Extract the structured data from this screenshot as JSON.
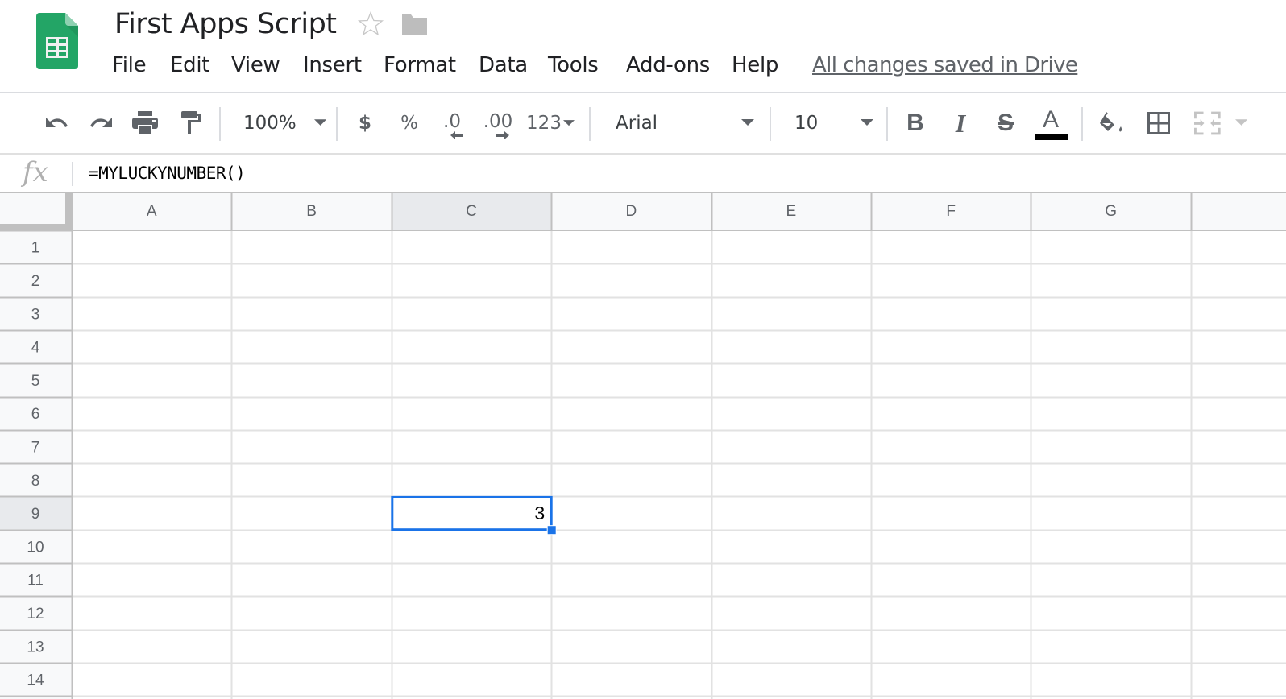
{
  "app": {
    "name": "Google Sheets",
    "title": "First Apps Script",
    "icons": {
      "logo": "sheets-logo-icon",
      "star": "star-icon",
      "folder": "folder-icon"
    },
    "brand_color": "#23a566"
  },
  "menu": {
    "items": [
      {
        "label": "File"
      },
      {
        "label": "Edit"
      },
      {
        "label": "View"
      },
      {
        "label": "Insert"
      },
      {
        "label": "Format"
      },
      {
        "label": "Data"
      },
      {
        "label": "Tools"
      },
      {
        "label": "Add-ons"
      },
      {
        "label": "Help"
      }
    ],
    "save_status": "All changes saved in Drive"
  },
  "toolbar": {
    "undo": "undo-icon",
    "redo": "redo-icon",
    "print": "print-icon",
    "paint_format": "paint-format-icon",
    "zoom": "100%",
    "currency": "$",
    "percent": "%",
    "decrease_decimal": ".0",
    "increase_decimal": ".00",
    "more_formats": "123",
    "font": "Arial",
    "font_size": "10",
    "bold": "B",
    "italic": "I",
    "strikethrough": "S",
    "text_color_label": "A",
    "text_color": "#000000",
    "fill_color": "fill-color-icon",
    "borders": "borders-icon",
    "merge": "merge-cells-icon"
  },
  "formula_bar": {
    "fx_label": "fx",
    "value": "=MYLUCKYNUMBER()"
  },
  "sheet": {
    "columns": [
      "A",
      "B",
      "C",
      "D",
      "E",
      "F",
      "G"
    ],
    "rows": [
      "1",
      "2",
      "3",
      "4",
      "5",
      "6",
      "7",
      "8",
      "9",
      "10",
      "11",
      "12",
      "13",
      "14"
    ],
    "selected_cell": "C9",
    "selected_column": "C",
    "selected_row": "9",
    "cells": [
      {
        "ref": "C9",
        "col": "C",
        "row": "9",
        "value": "3"
      }
    ],
    "selection_color": "#1a73e8"
  }
}
